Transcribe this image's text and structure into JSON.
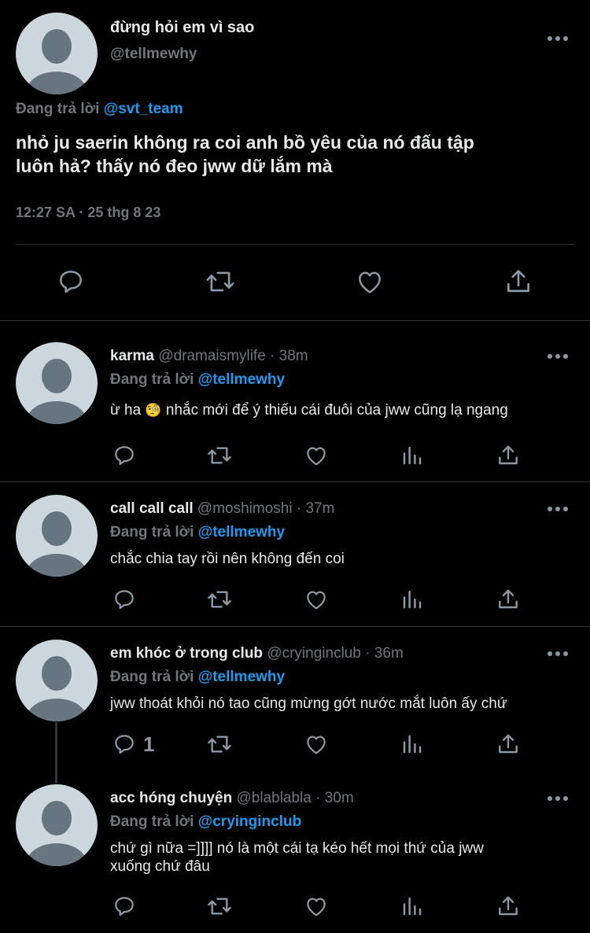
{
  "main_tweet": {
    "display_name": "đừng hỏi em vì sao",
    "handle": "@tellmewhy",
    "replying_prefix": "Đang trả lời",
    "replying_to": "@svt_team",
    "text_line1": "nhỏ ju saerin không ra coi anh bồ yêu của nó đấu tập",
    "text_line2": "luôn hả? thấy nó đeo jww dữ lắm mà",
    "timestamp": "12:27 SA · 25 thg 8 23"
  },
  "replies": [
    {
      "display_name": "karma",
      "handle": "@dramaismylife · 38m",
      "replying_prefix": "Đang trả lời",
      "replying_to": "@tellmewhy",
      "text_before": "ừ ha",
      "emoji": "🧐",
      "text_after": "nhắc mới để ý thiếu cái đuôi của jww cũng lạ ngang"
    },
    {
      "display_name": "call call call",
      "handle": "@moshimoshi · 37m",
      "replying_prefix": "Đang trả lời",
      "replying_to": "@tellmewhy",
      "text": "chắc chia tay rồi nên không đến coi"
    },
    {
      "display_name": "em khóc ở trong club",
      "handle": "@cryinginclub · 36m",
      "replying_prefix": "Đang trả lời",
      "replying_to": "@tellmewhy",
      "text": "jww thoát khỏi nó tao cũng mừng gớt nước mắt luôn ấy chứ",
      "reply_count": "1"
    },
    {
      "display_name": "acc hóng chuyện",
      "handle": "@blablabla · 30m",
      "replying_prefix": "Đang trả lời",
      "replying_to": "@cryinginclub",
      "text_line1": "chứ gì nữa =]]]] nó là một cái tạ kéo hết mọi thứ của jww",
      "text_line2": "xuống chứ đâu"
    }
  ],
  "icons": [
    "reply-icon",
    "retweet-icon",
    "like-icon",
    "views-icon",
    "share-icon",
    "more-icon"
  ],
  "colors": {
    "background": "#000000",
    "text": "#e7e9ea",
    "muted": "#71767b",
    "link": "#1d9bf0",
    "divider": "#2f3336"
  }
}
